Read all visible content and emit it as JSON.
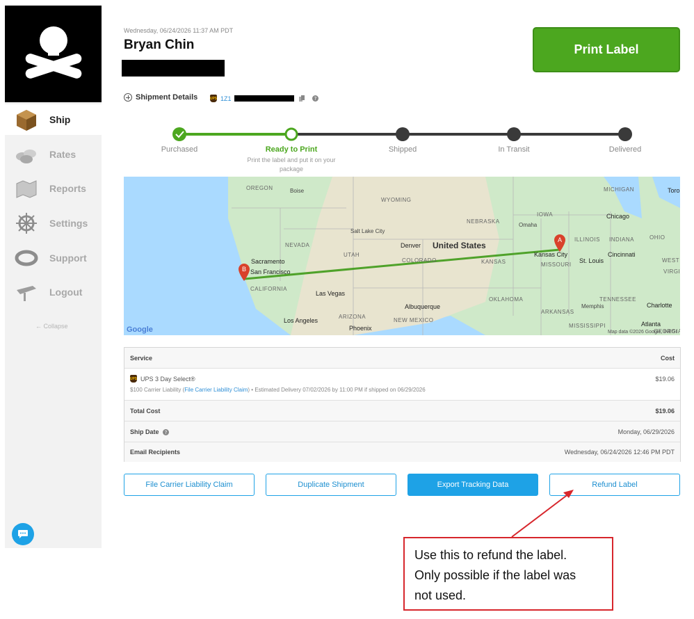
{
  "header": {
    "timestamp": "Wednesday, 06/24/2026 11:37 AM PDT",
    "customer_name": "Bryan Chin",
    "print_label": "Print Label",
    "shipment_details": "Shipment Details",
    "tracking_prefix": "1Z1"
  },
  "sidebar": {
    "items": [
      {
        "label": "Ship",
        "icon": "package-icon"
      },
      {
        "label": "Rates",
        "icon": "coins-icon"
      },
      {
        "label": "Reports",
        "icon": "map-icon"
      },
      {
        "label": "Settings",
        "icon": "ship-wheel-icon"
      },
      {
        "label": "Support",
        "icon": "life-ring-icon"
      },
      {
        "label": "Logout",
        "icon": "plank-icon"
      }
    ],
    "collapse": "← Collapse"
  },
  "progress": {
    "steps": [
      {
        "label": "Purchased",
        "state": "done"
      },
      {
        "label": "Ready to Print",
        "state": "current"
      },
      {
        "label": "Shipped",
        "state": "pending"
      },
      {
        "label": "In Transit",
        "state": "pending"
      },
      {
        "label": "Delivered",
        "state": "pending"
      }
    ],
    "current_sub": "Print the label and put it on your package"
  },
  "map": {
    "labels": {
      "oregon": "OREGON",
      "boise": "Boise",
      "wyoming": "WYOMING",
      "nebraska": "NEBRASKA",
      "iowa": "IOWA",
      "omaha": "Omaha",
      "chicago": "Chicago",
      "michigan": "MICHIGAN",
      "toronto": "Toro",
      "salt_lake": "Salt Lake City",
      "nevada": "NEVADA",
      "utah": "UTAH",
      "denver": "Denver",
      "united_states": "United States",
      "illinois": "ILLINOIS",
      "indiana": "INDIANA",
      "ohio": "OHIO",
      "sacramento": "Sacramento",
      "colorado": "COLORADO",
      "kansas": "KANSAS",
      "kansas_city": "Kansas City",
      "missouri": "MISSOURI",
      "st_louis": "St. Louis",
      "cincinnati": "Cincinnati",
      "west_virginia": "WEST",
      "virginia": "VIRGI",
      "san_francisco": "San Francisco",
      "california": "CALIFORNIA",
      "las_vegas": "Las Vegas",
      "oklahoma": "OKLAHOMA",
      "tennessee": "TENNESSEE",
      "albuquerque": "Albuquerque",
      "memphis": "Memphis",
      "charlotte": "Charlotte",
      "arkansas": "ARKANSAS",
      "arizona": "ARIZONA",
      "new_mexico": "NEW MEXICO",
      "los_angeles": "Los Angeles",
      "phoenix": "Phoenix",
      "mississippi": "MISSISSIPPI",
      "atlanta": "Atlanta",
      "georgia": "GEORGIA",
      "google": "Google",
      "attribution": "Map data ©2026 Google, INEGI"
    },
    "marker_a": "A",
    "marker_b": "B"
  },
  "table": {
    "service_header": "Service",
    "cost_header": "Cost",
    "service_name": "UPS 3 Day Select®",
    "service_cost": "$19.06",
    "liability_prefix": "$100 Carrier Liability (",
    "liability_link": "File Carrier Liability Claim",
    "liability_suffix": ")  •  Estimated Delivery 07/02/2026 by 11:00 PM if shipped on 06/29/2026",
    "total_label": "Total Cost",
    "total_value": "$19.06",
    "ship_date_label": "Ship Date",
    "ship_date_value": "Monday, 06/29/2026",
    "email_label": "Email Recipients",
    "email_value": "Wednesday, 06/24/2026 12:46 PM PDT"
  },
  "actions": {
    "file_claim": "File Carrier Liability Claim",
    "duplicate": "Duplicate Shipment",
    "export": "Export Tracking Data",
    "refund": "Refund Label"
  },
  "callout": {
    "line1": "Use this to refund the label.",
    "line2": "Only possible if the label was",
    "line3": "not used."
  },
  "colors": {
    "green": "#4ca71f",
    "blue": "#1ea2e6",
    "callout_red": "#d7262c"
  }
}
